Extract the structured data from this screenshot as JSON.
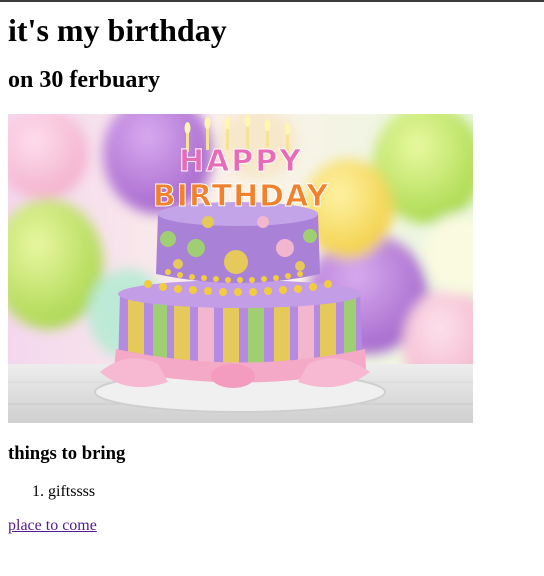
{
  "heading": "it's my birthday",
  "subheading": "on 30 ferbuary",
  "image": {
    "cake_text_top": "HAPPY",
    "cake_text_bottom": "BIRTHDAY"
  },
  "section_title": "things to bring",
  "items": [
    "giftssss"
  ],
  "link_text": "place to come",
  "colors": {
    "link_visited": "#551a8b",
    "top_border": "#3c3c3c"
  }
}
